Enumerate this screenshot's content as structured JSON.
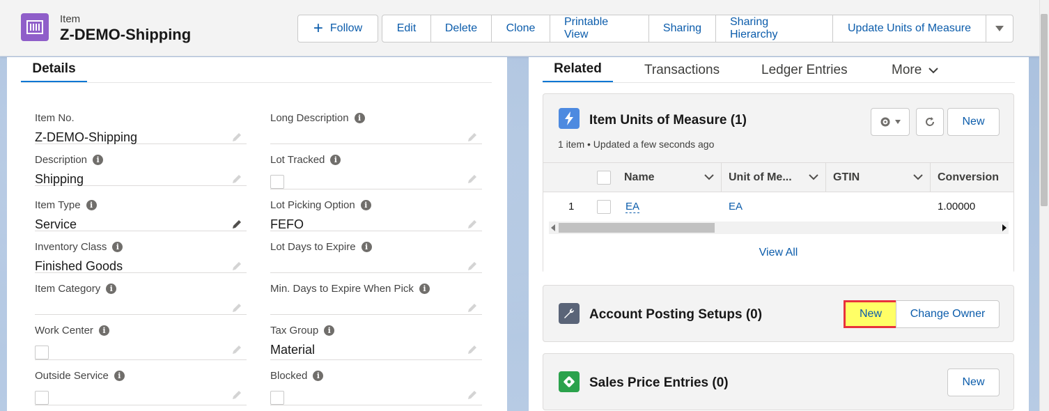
{
  "header": {
    "object_type": "Item",
    "record_name": "Z-DEMO-Shipping",
    "follow_label": "Follow",
    "actions": [
      "Edit",
      "Delete",
      "Clone",
      "Printable View",
      "Sharing",
      "Sharing Hierarchy",
      "Update Units of Measure"
    ]
  },
  "details": {
    "tab_label": "Details",
    "fields_left": [
      {
        "label": "Item No.",
        "value": "Z-DEMO-Shipping"
      },
      {
        "label": "Description",
        "value": "Shipping"
      },
      {
        "label": "Item Type",
        "value": "Service"
      },
      {
        "label": "Inventory Class",
        "value": "Finished Goods"
      },
      {
        "label": "Item Category",
        "value": ""
      },
      {
        "label": "Work Center",
        "value": ""
      },
      {
        "label": "Outside Service",
        "value": ""
      }
    ],
    "fields_right": [
      {
        "label": "Long Description",
        "value": ""
      },
      {
        "label": "Lot Tracked",
        "value": ""
      },
      {
        "label": "Lot Picking Option",
        "value": "FEFO"
      },
      {
        "label": "Lot Days to Expire",
        "value": ""
      },
      {
        "label": "Min. Days to Expire When Pick",
        "value": ""
      },
      {
        "label": "Tax Group",
        "value": "Material"
      },
      {
        "label": "Blocked",
        "value": ""
      }
    ]
  },
  "related": {
    "tabs": [
      "Related",
      "Transactions",
      "Ledger Entries",
      "More"
    ],
    "uom_card": {
      "title": "Item Units of Measure (1)",
      "subtitle": "1 item • Updated a few seconds ago",
      "new_label": "New",
      "columns": [
        "Name",
        "Unit of Me...",
        "GTIN",
        "Conversion"
      ],
      "row": {
        "index": "1",
        "name": "EA",
        "unit": "EA",
        "gtin": "",
        "conversion": "1.00000"
      },
      "view_all": "View All"
    },
    "posting_card": {
      "title": "Account Posting Setups (0)",
      "new_label": "New",
      "change_owner_label": "Change Owner"
    },
    "sales_card": {
      "title": "Sales Price Entries (0)",
      "new_label": "New"
    }
  },
  "colors": {
    "brand_blue": "#0176d3",
    "link_blue": "#0b5cab",
    "item_icon": "#8f5ec9",
    "uom_icon": "#4d8ae0",
    "posting_icon": "#5a6478",
    "sales_icon": "#2ba24c",
    "highlight_fill": "#ffff66",
    "highlight_border": "#e8323c"
  }
}
